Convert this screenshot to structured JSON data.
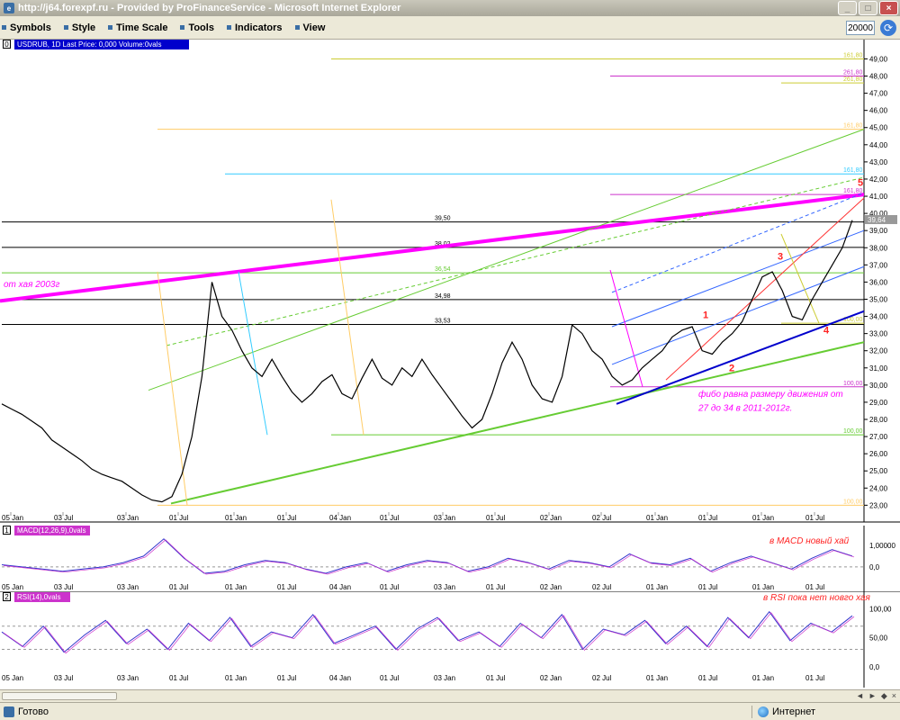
{
  "window": {
    "title": "http://j64.forexpf.ru - Provided by ProFinanceService - Microsoft Internet Explorer",
    "icon": "ie-page-icon",
    "buttons": [
      "_",
      "□",
      "×"
    ]
  },
  "menu": [
    {
      "label": "Symbols",
      "icon": "symbols-icon"
    },
    {
      "label": "Style",
      "icon": "style-icon"
    },
    {
      "label": "Time Scale",
      "icon": "timescale-icon"
    },
    {
      "label": "Tools",
      "icon": "tools-icon"
    },
    {
      "label": "Indicators",
      "icon": "indicators-icon"
    },
    {
      "label": "View",
      "icon": "view-icon"
    }
  ],
  "zoom_value": "20000",
  "status": {
    "text": "Готово",
    "zone": "Интернет"
  },
  "scroll_controls": [
    "◄",
    "►",
    "◆",
    "×"
  ],
  "colors": {
    "price": "#000000",
    "magenta": "#ff00ff",
    "green": "#66cc33",
    "blue": "#0000cc",
    "grid_blue": "#3366ff",
    "orange": "#ffcc66",
    "cyan": "#33ccff",
    "red": "#ff3333",
    "macd_hist": "#33aa22",
    "rsi_purple": "#cc33cc"
  },
  "chart_data": [
    {
      "type": "line",
      "title": "USDRUB, 1D Last Price: 0,000 Volume:0vals",
      "pane_index": "0",
      "x": [
        "05 Jan",
        "03 Jul",
        "03 Jan",
        "01 Jul",
        "01 Jan",
        "01 Jul",
        "04 Jan",
        "01 Jul",
        "03 Jan",
        "01 Jul",
        "02 Jan",
        "02 Jul",
        "01 Jan",
        "01 Jul",
        "01 Jan",
        "01 Jul"
      ],
      "ylim": [
        22.6,
        49.6
      ],
      "y_ticks": [
        "49,00",
        "48,00",
        "47,00",
        "46,00",
        "45,00",
        "44,00",
        "43,00",
        "42,00",
        "41,00",
        "40,00",
        "39,00",
        "38,00",
        "37,00",
        "36,00",
        "35,00",
        "34,00",
        "33,00",
        "32,00",
        "31,00",
        "30,00",
        "29,00",
        "28,00",
        "27,00",
        "26,00",
        "25,00",
        "24,00",
        "23,00"
      ],
      "last_value_label": "39,64",
      "series": [
        {
          "values": [
            28.9,
            28.6,
            28.3,
            27.9,
            27.5,
            26.8,
            26.4,
            26.0,
            25.6,
            25.1,
            24.8,
            24.6,
            24.4,
            24.0,
            23.6,
            23.3,
            23.2,
            23.5,
            24.8,
            27.0,
            30.5,
            36.0,
            34.0,
            33.2,
            32.0,
            31.0,
            30.5,
            31.5,
            30.5,
            29.6,
            29.0,
            29.5,
            30.2,
            30.6,
            29.5,
            29.2,
            30.4,
            31.5,
            30.4,
            30.0,
            31.0,
            30.5,
            31.5,
            30.6,
            29.8,
            29.0,
            28.2,
            27.5,
            28.0,
            29.5,
            31.3,
            32.5,
            31.5,
            30.0,
            29.2,
            29.0,
            30.5,
            33.5,
            33.0,
            32.0,
            31.5,
            30.5,
            30.0,
            30.3,
            31.0,
            31.5,
            32.0,
            32.8,
            33.2,
            33.4,
            32.0,
            31.8,
            32.5,
            33.0,
            33.7,
            35.0,
            36.3,
            36.6,
            35.5,
            34.0,
            33.8,
            35.0,
            36.0,
            37.0,
            38.0,
            39.6
          ]
        }
      ],
      "hlines": [
        {
          "label": "161,80",
          "value": 49.0,
          "color": "#cccc33"
        },
        {
          "label": "261,80",
          "value": 48.0,
          "color": "#cc33cc"
        },
        {
          "label": "261,80",
          "value": 47.6,
          "color": "#cccc33"
        },
        {
          "label": "161,80",
          "value": 44.9,
          "color": "#ffcc66"
        },
        {
          "label": "161,80",
          "value": 42.3,
          "color": "#33ccff"
        },
        {
          "label": "161,80",
          "value": 41.1,
          "color": "#cc33cc"
        },
        {
          "label": "39,50",
          "value": 39.5,
          "color": "#000000"
        },
        {
          "label": "38,02",
          "value": 38.02,
          "color": "#000000"
        },
        {
          "label": "36,54",
          "value": 36.54,
          "color": "#66cc33"
        },
        {
          "label": "34,98",
          "value": 34.98,
          "color": "#000000"
        },
        {
          "label": "33,53",
          "value": 33.53,
          "color": "#000000"
        },
        {
          "label": "100,00",
          "value": 33.6,
          "color": "#cccc33"
        },
        {
          "label": "100,00",
          "value": 29.9,
          "color": "#cc33cc"
        },
        {
          "label": "100,00",
          "value": 27.1,
          "color": "#66cc33"
        },
        {
          "label": "100,00",
          "value": 23.0,
          "color": "#ffcc66"
        }
      ],
      "wave_labels": [
        "1",
        "2",
        "3",
        "4",
        "5"
      ],
      "annotations": [
        "от хая 2003г",
        "фибо равна размеру движения от",
        "27 до 34 в 2011-2012г."
      ]
    },
    {
      "type": "line",
      "title": "MACD(12,26,9),0vals",
      "pane_index": "1",
      "ylim": [
        -0.8,
        1.5
      ],
      "y_ticks": [
        "1,00000",
        "0,0"
      ],
      "annotations": [
        "в MACD новый хай"
      ],
      "series": [
        {
          "values": [
            0.1,
            0.0,
            -0.1,
            -0.2,
            -0.1,
            0.0,
            0.2,
            0.5,
            1.3,
            0.4,
            -0.3,
            -0.2,
            0.1,
            0.3,
            0.2,
            -0.1,
            -0.3,
            0.0,
            0.2,
            -0.2,
            0.1,
            0.3,
            0.2,
            -0.2,
            0.0,
            0.4,
            0.2,
            -0.1,
            0.3,
            0.2,
            0.0,
            0.6,
            0.2,
            0.1,
            0.4,
            -0.2,
            0.2,
            0.5,
            0.2,
            -0.1,
            0.4,
            0.8,
            0.5
          ]
        }
      ]
    },
    {
      "type": "line",
      "title": "RSI(14),0vals",
      "pane_index": "2",
      "ylim": [
        -5,
        110
      ],
      "y_ticks": [
        "100,00",
        "50,00",
        "0,0"
      ],
      "annotations": [
        "в RSI пока нет новго хая"
      ],
      "series": [
        {
          "values": [
            60,
            35,
            70,
            25,
            55,
            80,
            40,
            65,
            30,
            75,
            45,
            85,
            35,
            60,
            50,
            90,
            40,
            55,
            70,
            30,
            65,
            85,
            45,
            60,
            35,
            75,
            50,
            90,
            30,
            65,
            55,
            80,
            40,
            70,
            35,
            85,
            50,
            95,
            45,
            75,
            60,
            88
          ]
        }
      ]
    }
  ],
  "x_axis_labels_bottom": [
    "05 Jan",
    "03 Jul",
    "03 Jan",
    "01 Jul",
    "01 Jan",
    "01 Jul",
    "04 Jan",
    "01 Jul",
    "03 Jan",
    "01 Jul",
    "02 Jan",
    "02 Jul",
    "01 Jan",
    "01 Jul",
    "01 Jan",
    "01 Jul"
  ]
}
